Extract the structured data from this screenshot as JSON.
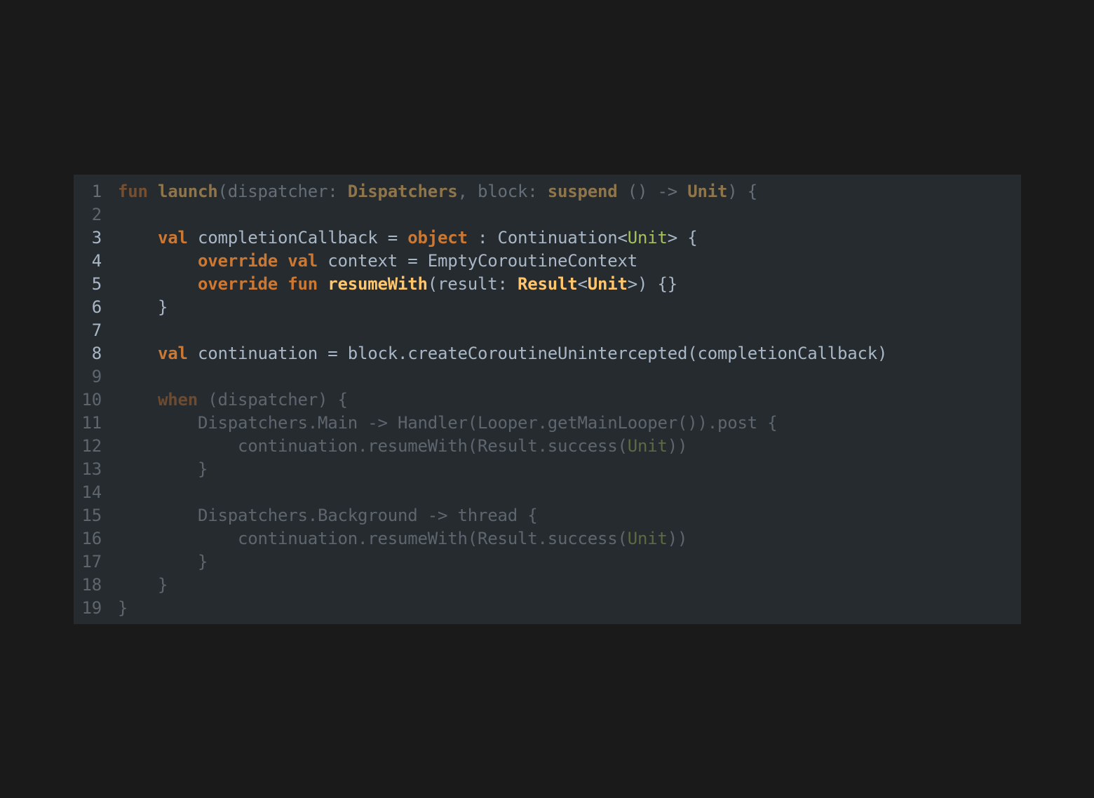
{
  "colors": {
    "background": "#1a1a1a",
    "panel": "#262b2f",
    "keyword": "#cc7832",
    "function": "#ffc66d",
    "type_param": "#a5c25c",
    "text": "#a9b7c6"
  },
  "lines": [
    {
      "n": "1",
      "dim": true,
      "tokens": [
        {
          "t": "fun",
          "c": "kw"
        },
        {
          "t": " ",
          "c": "txt"
        },
        {
          "t": "launch",
          "c": "fn"
        },
        {
          "t": "(dispatcher: ",
          "c": "txt"
        },
        {
          "t": "Dispatchers",
          "c": "ty-bold"
        },
        {
          "t": ", block: ",
          "c": "txt"
        },
        {
          "t": "suspend",
          "c": "ty-bold"
        },
        {
          "t": " () -> ",
          "c": "txt"
        },
        {
          "t": "Unit",
          "c": "ty-bold"
        },
        {
          "t": ") {",
          "c": "txt"
        }
      ]
    },
    {
      "n": "2",
      "dim": true,
      "tokens": []
    },
    {
      "n": "3",
      "dim": false,
      "tokens": [
        {
          "t": "    ",
          "c": "txt"
        },
        {
          "t": "val",
          "c": "kw"
        },
        {
          "t": " completionCallback = ",
          "c": "txt"
        },
        {
          "t": "object",
          "c": "kw"
        },
        {
          "t": " : Continuation<",
          "c": "txt"
        },
        {
          "t": "Unit",
          "c": "green"
        },
        {
          "t": "> {",
          "c": "txt"
        }
      ]
    },
    {
      "n": "4",
      "dim": false,
      "tokens": [
        {
          "t": "        ",
          "c": "txt"
        },
        {
          "t": "override",
          "c": "kw"
        },
        {
          "t": " ",
          "c": "txt"
        },
        {
          "t": "val",
          "c": "kw"
        },
        {
          "t": " context = EmptyCoroutineContext",
          "c": "txt"
        }
      ]
    },
    {
      "n": "5",
      "dim": false,
      "tokens": [
        {
          "t": "        ",
          "c": "txt"
        },
        {
          "t": "override",
          "c": "kw"
        },
        {
          "t": " ",
          "c": "txt"
        },
        {
          "t": "fun",
          "c": "kw"
        },
        {
          "t": " ",
          "c": "txt"
        },
        {
          "t": "resumeWith",
          "c": "fn"
        },
        {
          "t": "(result: ",
          "c": "txt"
        },
        {
          "t": "Result",
          "c": "ty-bold"
        },
        {
          "t": "<",
          "c": "txt"
        },
        {
          "t": "Unit",
          "c": "ty-bold"
        },
        {
          "t": ">) {}",
          "c": "txt"
        }
      ]
    },
    {
      "n": "6",
      "dim": false,
      "tokens": [
        {
          "t": "    }",
          "c": "txt"
        }
      ]
    },
    {
      "n": "7",
      "dim": false,
      "tokens": []
    },
    {
      "n": "8",
      "dim": false,
      "tokens": [
        {
          "t": "    ",
          "c": "txt"
        },
        {
          "t": "val",
          "c": "kw"
        },
        {
          "t": " continuation = block.createCoroutineUnintercepted(completionCallback)",
          "c": "txt"
        }
      ]
    },
    {
      "n": "9",
      "dim": true,
      "tokens": []
    },
    {
      "n": "10",
      "dim": true,
      "tokens": [
        {
          "t": "    ",
          "c": "txt"
        },
        {
          "t": "when",
          "c": "kw"
        },
        {
          "t": " (dispatcher) {",
          "c": "txt"
        }
      ]
    },
    {
      "n": "11",
      "dim": true,
      "tokens": [
        {
          "t": "        Dispatchers.Main -> Handler(Looper.getMainLooper()).post {",
          "c": "txt"
        }
      ]
    },
    {
      "n": "12",
      "dim": true,
      "tokens": [
        {
          "t": "            continuation.resumeWith(Result.success(",
          "c": "txt"
        },
        {
          "t": "Unit",
          "c": "green"
        },
        {
          "t": "))",
          "c": "txt"
        }
      ]
    },
    {
      "n": "13",
      "dim": true,
      "tokens": [
        {
          "t": "        }",
          "c": "txt"
        }
      ]
    },
    {
      "n": "14",
      "dim": true,
      "tokens": []
    },
    {
      "n": "15",
      "dim": true,
      "tokens": [
        {
          "t": "        Dispatchers.Background -> thread {",
          "c": "txt"
        }
      ]
    },
    {
      "n": "16",
      "dim": true,
      "tokens": [
        {
          "t": "            continuation.resumeWith(Result.success(",
          "c": "txt"
        },
        {
          "t": "Unit",
          "c": "green"
        },
        {
          "t": "))",
          "c": "txt"
        }
      ]
    },
    {
      "n": "17",
      "dim": true,
      "tokens": [
        {
          "t": "        }",
          "c": "txt"
        }
      ]
    },
    {
      "n": "18",
      "dim": true,
      "tokens": [
        {
          "t": "    }",
          "c": "txt"
        }
      ]
    },
    {
      "n": "19",
      "dim": true,
      "tokens": [
        {
          "t": "}",
          "c": "txt"
        }
      ]
    }
  ]
}
